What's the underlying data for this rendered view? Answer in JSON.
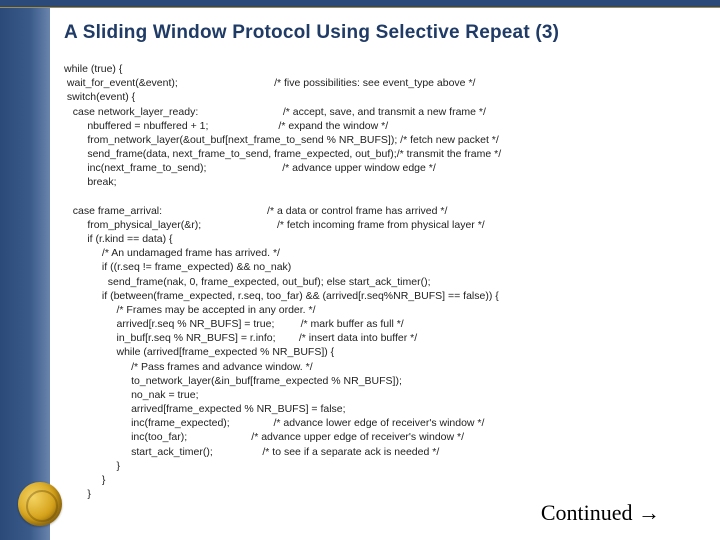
{
  "title": "A Sliding Window Protocol Using Selective Repeat (3)",
  "continued": "Continued →",
  "code_lines": [
    "while (true) {",
    " wait_for_event(&event);                                 /* five possibilities: see event_type above */",
    " switch(event) {",
    "   case network_layer_ready:                             /* accept, save, and transmit a new frame */",
    "        nbuffered = nbuffered + 1;                        /* expand the window */",
    "        from_network_layer(&out_buf[next_frame_to_send % NR_BUFS]); /* fetch new packet */",
    "        send_frame(data, next_frame_to_send, frame_expected, out_buf);/* transmit the frame */",
    "        inc(next_frame_to_send);                          /* advance upper window edge */",
    "        break;",
    "",
    "   case frame_arrival:                                    /* a data or control frame has arrived */",
    "        from_physical_layer(&r);                          /* fetch incoming frame from physical layer */",
    "        if (r.kind == data) {",
    "             /* An undamaged frame has arrived. */",
    "             if ((r.seq != frame_expected) && no_nak)",
    "               send_frame(nak, 0, frame_expected, out_buf); else start_ack_timer();",
    "             if (between(frame_expected, r.seq, too_far) && (arrived[r.seq%NR_BUFS] == false)) {",
    "                  /* Frames may be accepted in any order. */",
    "                  arrived[r.seq % NR_BUFS] = true;         /* mark buffer as full */",
    "                  in_buf[r.seq % NR_BUFS] = r.info;        /* insert data into buffer */",
    "                  while (arrived[frame_expected % NR_BUFS]) {",
    "                       /* Pass frames and advance window. */",
    "                       to_network_layer(&in_buf[frame_expected % NR_BUFS]);",
    "                       no_nak = true;",
    "                       arrived[frame_expected % NR_BUFS] = false;",
    "                       inc(frame_expected);               /* advance lower edge of receiver's window */",
    "                       inc(too_far);                      /* advance upper edge of receiver's window */",
    "                       start_ack_timer();                 /* to see if a separate ack is needed */",
    "                  }",
    "             }",
    "        }"
  ]
}
